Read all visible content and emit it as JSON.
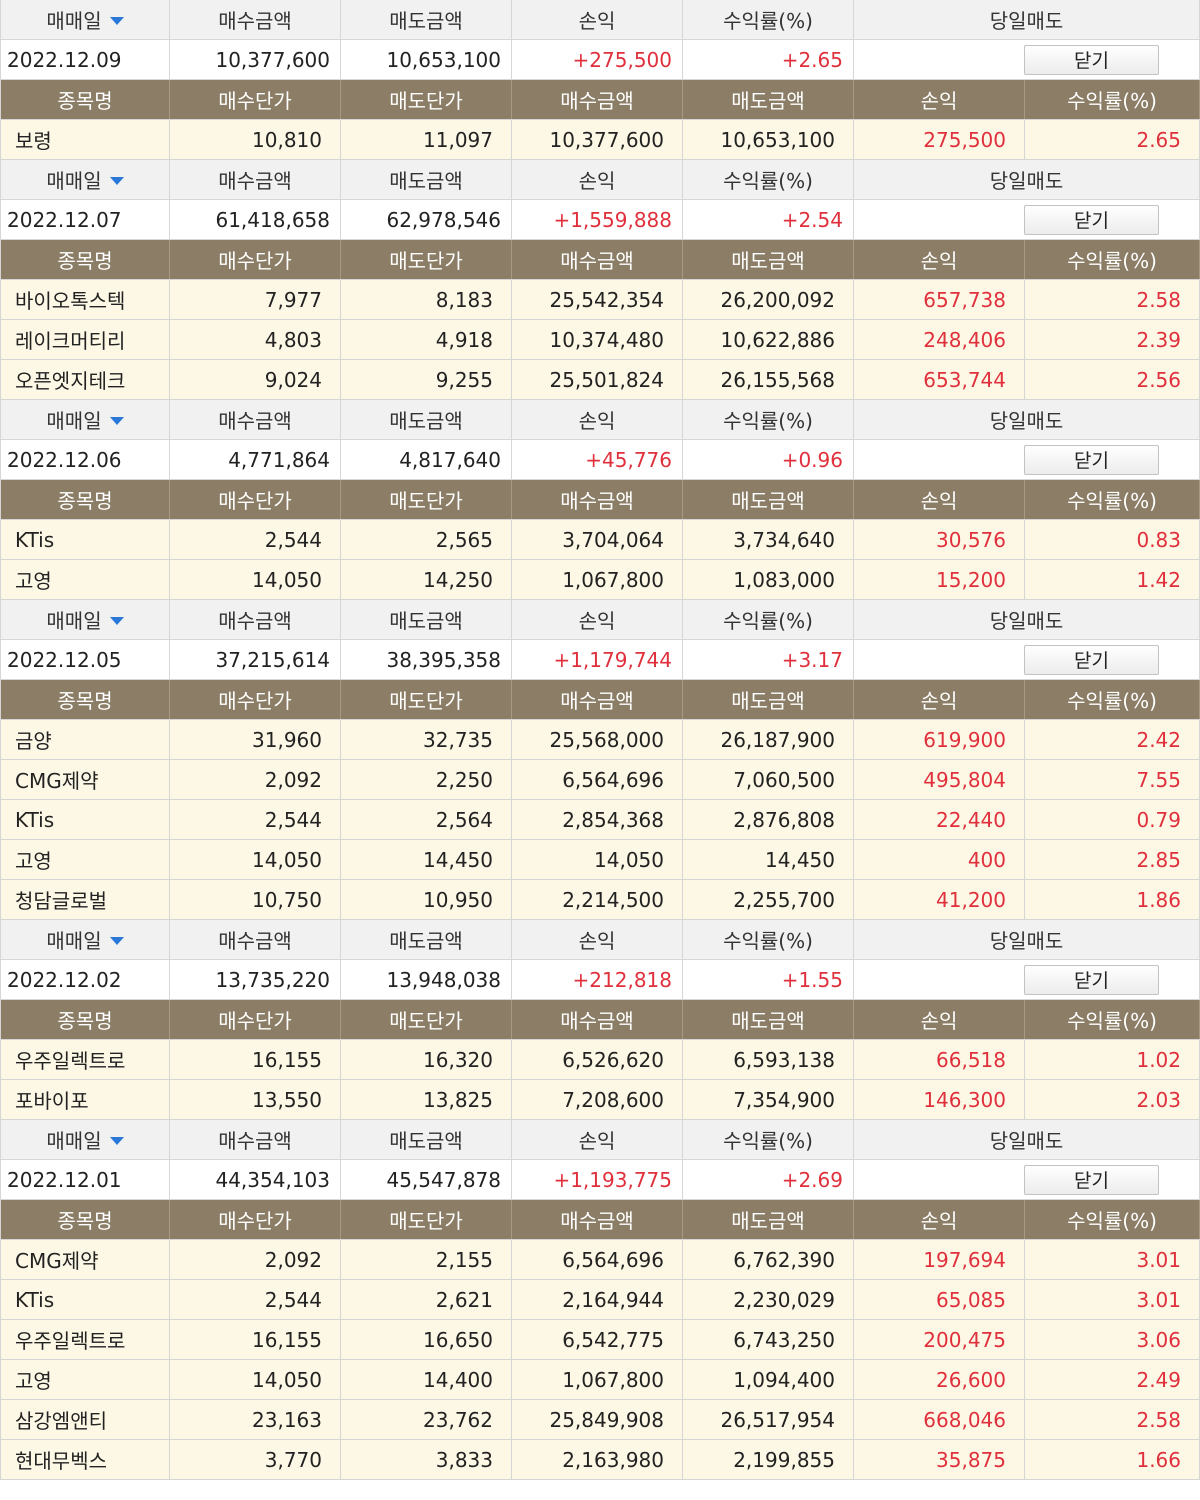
{
  "labels": {
    "trade_date": "매매일",
    "buy_amount": "매수금액",
    "sell_amount": "매도금액",
    "profit": "손익",
    "return_rate": "수익률(%)",
    "same_day_sell": "당일매도",
    "stock_name": "종목명",
    "buy_price": "매수단가",
    "sell_price": "매도단가",
    "close_button": "닫기"
  },
  "colors": {
    "detail_header_bg": "#8b7d66",
    "detail_row_bg": "#fdf8e6",
    "profit_red": "#e0303c",
    "sort_caret": "#2b78d8"
  },
  "icons": {
    "sort": "chevron-down-icon"
  },
  "groups": [
    {
      "date": "2022.12.09",
      "buy": "10,377,600",
      "sell": "10,653,100",
      "profit": "+275,500",
      "rate": "+2.65",
      "items": [
        {
          "name": "보령",
          "buy_price": "10,810",
          "sell_price": "11,097",
          "buy_amount": "10,377,600",
          "sell_amount": "10,653,100",
          "profit": "275,500",
          "rate": "2.65"
        }
      ]
    },
    {
      "date": "2022.12.07",
      "buy": "61,418,658",
      "sell": "62,978,546",
      "profit": "+1,559,888",
      "rate": "+2.54",
      "items": [
        {
          "name": "바이오톡스텍",
          "buy_price": "7,977",
          "sell_price": "8,183",
          "buy_amount": "25,542,354",
          "sell_amount": "26,200,092",
          "profit": "657,738",
          "rate": "2.58"
        },
        {
          "name": "레이크머티리",
          "buy_price": "4,803",
          "sell_price": "4,918",
          "buy_amount": "10,374,480",
          "sell_amount": "10,622,886",
          "profit": "248,406",
          "rate": "2.39"
        },
        {
          "name": "오픈엣지테크",
          "buy_price": "9,024",
          "sell_price": "9,255",
          "buy_amount": "25,501,824",
          "sell_amount": "26,155,568",
          "profit": "653,744",
          "rate": "2.56"
        }
      ]
    },
    {
      "date": "2022.12.06",
      "buy": "4,771,864",
      "sell": "4,817,640",
      "profit": "+45,776",
      "rate": "+0.96",
      "items": [
        {
          "name": "KTis",
          "buy_price": "2,544",
          "sell_price": "2,565",
          "buy_amount": "3,704,064",
          "sell_amount": "3,734,640",
          "profit": "30,576",
          "rate": "0.83"
        },
        {
          "name": "고영",
          "buy_price": "14,050",
          "sell_price": "14,250",
          "buy_amount": "1,067,800",
          "sell_amount": "1,083,000",
          "profit": "15,200",
          "rate": "1.42"
        }
      ]
    },
    {
      "date": "2022.12.05",
      "buy": "37,215,614",
      "sell": "38,395,358",
      "profit": "+1,179,744",
      "rate": "+3.17",
      "items": [
        {
          "name": "금양",
          "buy_price": "31,960",
          "sell_price": "32,735",
          "buy_amount": "25,568,000",
          "sell_amount": "26,187,900",
          "profit": "619,900",
          "rate": "2.42"
        },
        {
          "name": "CMG제약",
          "buy_price": "2,092",
          "sell_price": "2,250",
          "buy_amount": "6,564,696",
          "sell_amount": "7,060,500",
          "profit": "495,804",
          "rate": "7.55"
        },
        {
          "name": "KTis",
          "buy_price": "2,544",
          "sell_price": "2,564",
          "buy_amount": "2,854,368",
          "sell_amount": "2,876,808",
          "profit": "22,440",
          "rate": "0.79"
        },
        {
          "name": "고영",
          "buy_price": "14,050",
          "sell_price": "14,450",
          "buy_amount": "14,050",
          "sell_amount": "14,450",
          "profit": "400",
          "rate": "2.85"
        },
        {
          "name": "청담글로벌",
          "buy_price": "10,750",
          "sell_price": "10,950",
          "buy_amount": "2,214,500",
          "sell_amount": "2,255,700",
          "profit": "41,200",
          "rate": "1.86"
        }
      ]
    },
    {
      "date": "2022.12.02",
      "buy": "13,735,220",
      "sell": "13,948,038",
      "profit": "+212,818",
      "rate": "+1.55",
      "items": [
        {
          "name": "우주일렉트로",
          "buy_price": "16,155",
          "sell_price": "16,320",
          "buy_amount": "6,526,620",
          "sell_amount": "6,593,138",
          "profit": "66,518",
          "rate": "1.02"
        },
        {
          "name": "포바이포",
          "buy_price": "13,550",
          "sell_price": "13,825",
          "buy_amount": "7,208,600",
          "sell_amount": "7,354,900",
          "profit": "146,300",
          "rate": "2.03"
        }
      ]
    },
    {
      "date": "2022.12.01",
      "buy": "44,354,103",
      "sell": "45,547,878",
      "profit": "+1,193,775",
      "rate": "+2.69",
      "items": [
        {
          "name": "CMG제약",
          "buy_price": "2,092",
          "sell_price": "2,155",
          "buy_amount": "6,564,696",
          "sell_amount": "6,762,390",
          "profit": "197,694",
          "rate": "3.01"
        },
        {
          "name": "KTis",
          "buy_price": "2,544",
          "sell_price": "2,621",
          "buy_amount": "2,164,944",
          "sell_amount": "2,230,029",
          "profit": "65,085",
          "rate": "3.01"
        },
        {
          "name": "우주일렉트로",
          "buy_price": "16,155",
          "sell_price": "16,650",
          "buy_amount": "6,542,775",
          "sell_amount": "6,743,250",
          "profit": "200,475",
          "rate": "3.06"
        },
        {
          "name": "고영",
          "buy_price": "14,050",
          "sell_price": "14,400",
          "buy_amount": "1,067,800",
          "sell_amount": "1,094,400",
          "profit": "26,600",
          "rate": "2.49"
        },
        {
          "name": "삼강엠앤티",
          "buy_price": "23,163",
          "sell_price": "23,762",
          "buy_amount": "25,849,908",
          "sell_amount": "26,517,954",
          "profit": "668,046",
          "rate": "2.58"
        },
        {
          "name": "현대무벡스",
          "buy_price": "3,770",
          "sell_price": "3,833",
          "buy_amount": "2,163,980",
          "sell_amount": "2,199,855",
          "profit": "35,875",
          "rate": "1.66"
        }
      ]
    }
  ]
}
